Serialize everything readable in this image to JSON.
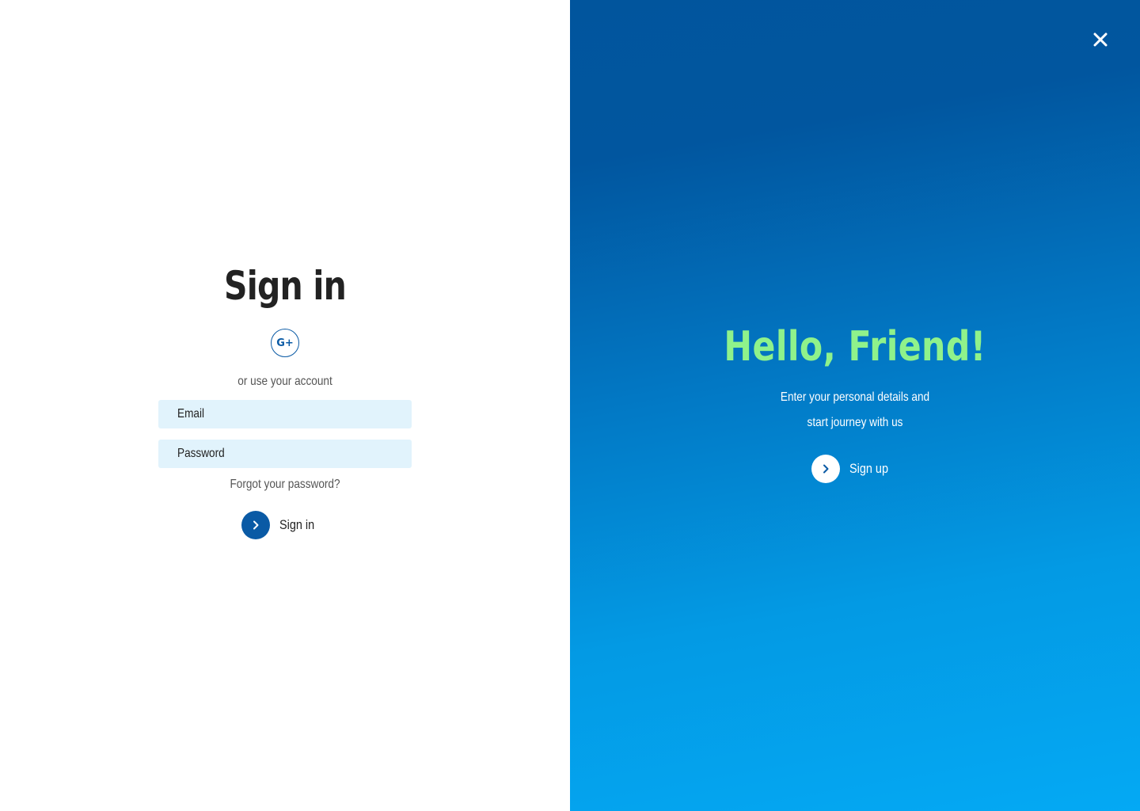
{
  "signin": {
    "title": "Sign in",
    "google_label": "G+",
    "or_text": "or use your account",
    "email_placeholder": "Email",
    "password_placeholder": "Password",
    "forgot_label": "Forgot your password?",
    "button_label": "Sign in",
    "button_icon": "chevron-right-icon"
  },
  "welcome": {
    "title": "Hello, Friend!",
    "subtitle": "Enter your personal details and start journey with us",
    "button_label": "Sign up",
    "button_icon": "chevron-right-icon",
    "close_icon": "close-icon"
  },
  "colors": {
    "primary": "#0a5aa5",
    "accent_green": "#8ff28b",
    "input_bg": "#e1f3fc",
    "gradient_top": "#01559d",
    "gradient_bottom": "#04a9f4"
  }
}
